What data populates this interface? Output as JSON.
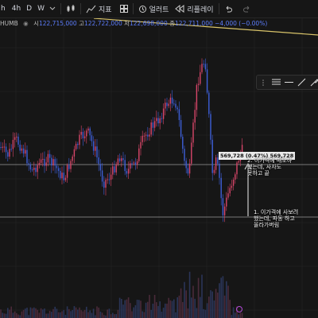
{
  "toolbar": {
    "symbol_fragment": "h",
    "intervals": [
      "4h",
      "D",
      "W"
    ],
    "indicators_label": "지표",
    "alert_label": "얼러트",
    "replay_label": "리플레이"
  },
  "ohlc": {
    "symbol_tail": "HUMB",
    "open_label": "시",
    "open_value": "122,715,000",
    "high_label": "고",
    "high_value": "122,722,000",
    "low_label": "저",
    "low_value": "122,698,000",
    "close_label": "종",
    "close_value": "122,711,000",
    "change_value": "−4,000 (−0.00%)"
  },
  "measure": {
    "text": "569,728 (0.47%) 569,728"
  },
  "notes": {
    "sell_note": [
      "2. 이가격에 매도하",
      "했는데, 사자도",
      "못하고 끝"
    ],
    "buy_note": [
      "1. 이가격에 사보려",
      "했는데, 파동 하고",
      "올라가버림"
    ]
  },
  "colors": {
    "up": "#d9466a",
    "down": "#3d5fd9",
    "trend_line": "#d9c46a",
    "background": "#161616"
  },
  "icons": [
    "candle-chart-icon",
    "indicators-icon",
    "layout-grid-icon",
    "alert-icon",
    "replay-icon",
    "undo-icon",
    "redo-icon"
  ]
}
